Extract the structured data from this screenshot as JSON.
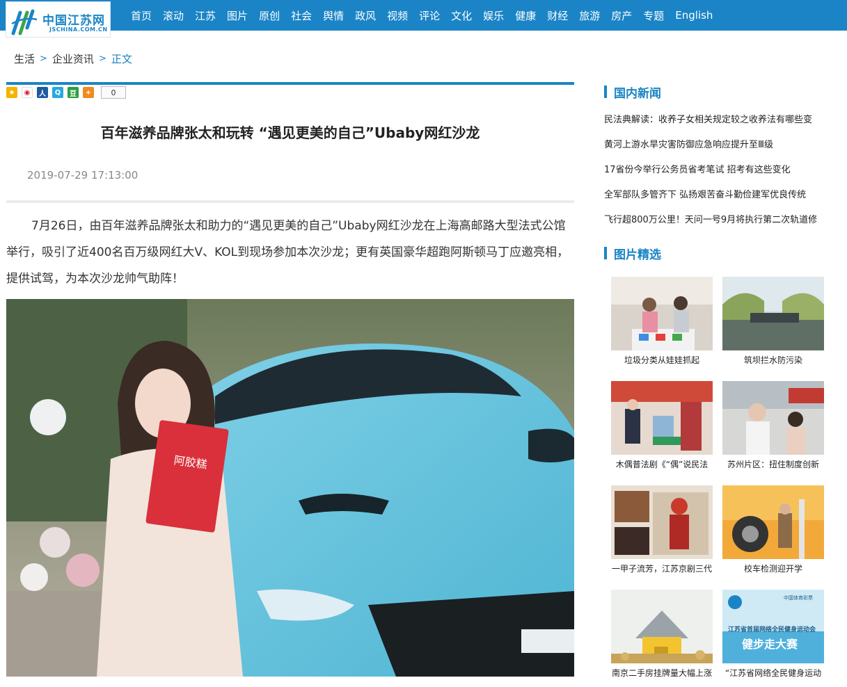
{
  "site": {
    "logo_cn": "中国江苏网",
    "logo_en": "JSCHINA.COM.CN"
  },
  "nav": [
    "首页",
    "滚动",
    "江苏",
    "图片",
    "原创",
    "社会",
    "舆情",
    "政风",
    "视频",
    "评论",
    "文化",
    "娱乐",
    "健康",
    "财经",
    "旅游",
    "房产",
    "专题",
    "English"
  ],
  "breadcrumb": {
    "home": "生活",
    "section": "企业资讯",
    "current": "正文",
    "separator": ">"
  },
  "share": {
    "count": "0"
  },
  "article": {
    "title": "百年滋养品牌张太和玩转 “遇见更美的自己”Ubaby网红沙龙",
    "date": "2019-07-29 17:13:00",
    "paragraph": "7月26日，由百年滋养品牌张太和助力的“遇见更美的自己”Ubaby网红沙龙在上海高邮路大型法式公馆举行，吸引了近400名百万级网红大V、KOL到现场参加本次沙龙；更有英国豪华超跑阿斯顿马丁应邀亮相，提供试驾，为本次沙龙帅气助阵！",
    "photo_text": "阿胶糕"
  },
  "sidebar": {
    "news_title": "国内新闻",
    "news": [
      "民法典解读：收养子女相关规定较之收养法有哪些变",
      "黄河上游水旱灾害防御应急响应提升至Ⅲ级",
      "17省份今举行公务员省考笔试 招考有这些变化",
      "全军部队多管齐下 弘扬艰苦奋斗勤俭建军优良传统",
      "飞行超800万公里！天问一号9月将执行第二次轨道修"
    ],
    "pics_title": "图片精选",
    "pics": [
      {
        "caption": "垃圾分类从娃娃抓起"
      },
      {
        "caption": "筑坝拦水防污染"
      },
      {
        "caption": "木偶普法剧《“偶”说民法"
      },
      {
        "caption": "苏州片区：扭住制度创新"
      },
      {
        "caption": "一甲子流芳，江苏京剧三代"
      },
      {
        "caption": "校车检测迎开学"
      },
      {
        "caption": "南京二手房挂牌量大幅上涨"
      },
      {
        "caption": "“江苏省网络全民健身运动"
      }
    ],
    "poster_lottery": "中国体育彩票",
    "poster_line1": "江苏省首届网络全民健身运动会",
    "poster_line2": "健步走大赛"
  },
  "colors": {
    "brand": "#1a84c6"
  }
}
